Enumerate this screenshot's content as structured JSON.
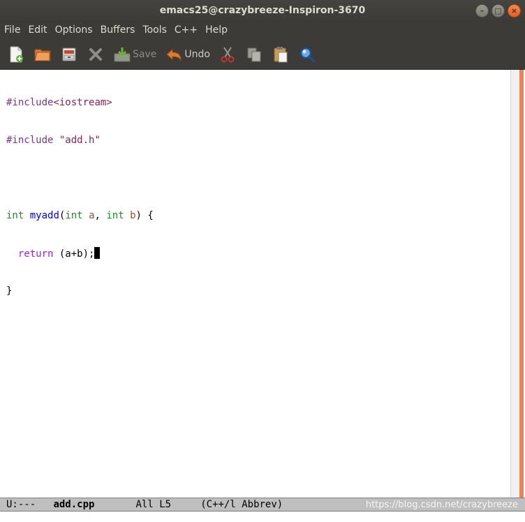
{
  "window": {
    "title": "emacs25@crazybreeze-Inspiron-3670"
  },
  "menu": [
    "File",
    "Edit",
    "Options",
    "Buffers",
    "Tools",
    "C++",
    "Help"
  ],
  "toolbar": {
    "save_label": "Save",
    "undo_label": "Undo"
  },
  "code": {
    "l1a": "#include",
    "l1b": "<iostream>",
    "l2a": "#include",
    "l2b": "\"add.h\"",
    "l4_type1": "int",
    "l4_fn": "myadd",
    "l4_p1": "(",
    "l4_type2": "int",
    "l4_var1": "a",
    "l4_comma": ", ",
    "l4_type3": "int",
    "l4_var2": "b",
    "l4_end": ") {",
    "l5_kw": "return",
    "l5_rest": "(a+b);",
    "l6": "}"
  },
  "modeline": {
    "status": "U:---",
    "buffer": "add.cpp",
    "position": "All L5",
    "mode": "(C++/l Abbrev)"
  },
  "watermark": "https://blog.csdn.net/crazybreeze",
  "colors": {
    "accent": "#e8845a",
    "chrome": "#3c3b37"
  }
}
